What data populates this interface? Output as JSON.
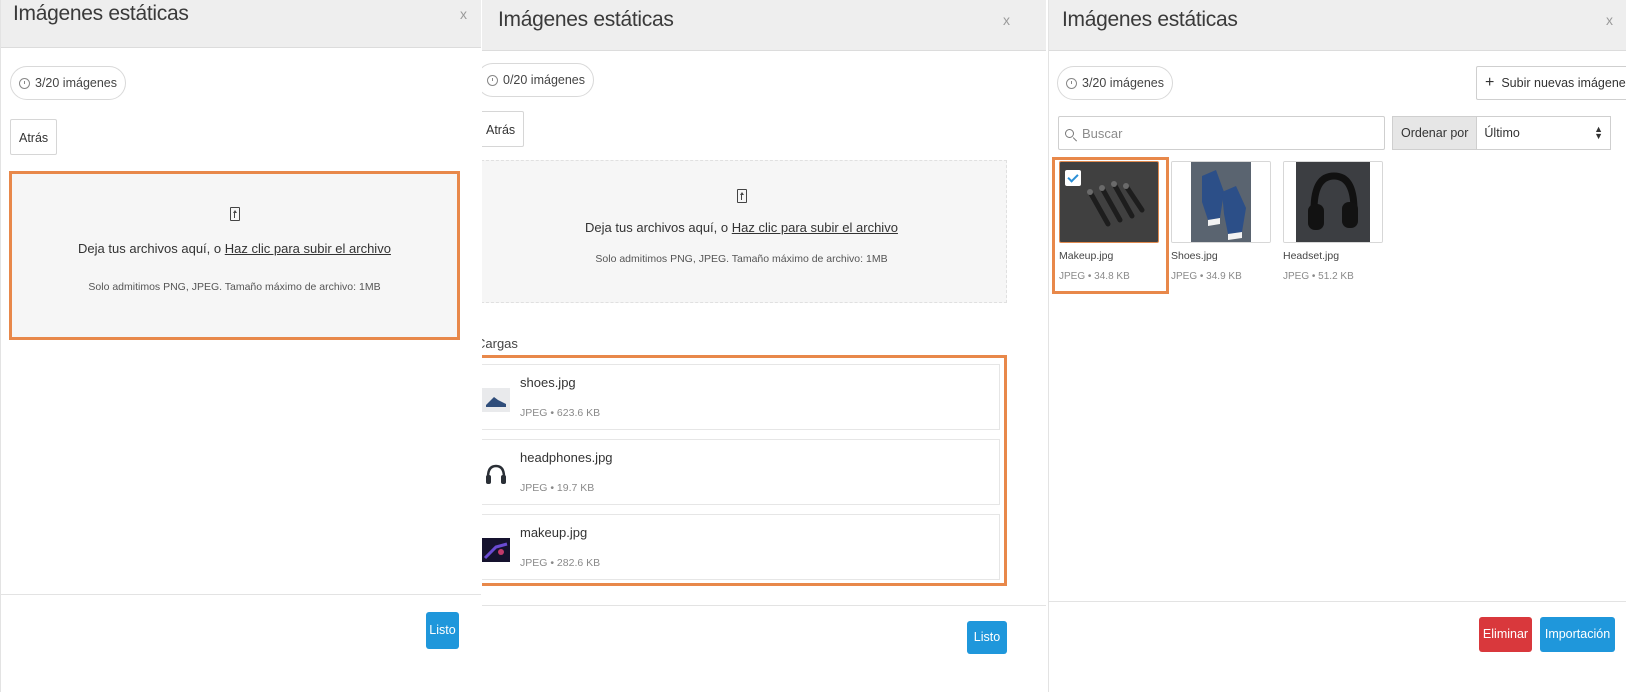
{
  "panel1": {
    "title": "Imágenes estáticas",
    "close": "x",
    "counter": "3/20 imágenes",
    "back_label": "Atrás",
    "dropzone": {
      "prefix": "Deja tus archivos aquí, o ",
      "link": "Haz clic para subir el archivo",
      "note": "Solo admitimos PNG, JPEG. Tamaño máximo de archivo: 1MB"
    },
    "done_label": "Listo"
  },
  "panel2": {
    "title": "Imágenes estáticas",
    "close": "x",
    "counter": "0/20 imágenes",
    "back_label": "Atrás",
    "dropzone": {
      "prefix": "Deja tus archivos aquí, o ",
      "link": "Haz clic para subir el archivo",
      "note": "Solo admitimos PNG, JPEG. Tamaño máximo de archivo: 1MB"
    },
    "uploads_label": "Cargas",
    "uploads": [
      {
        "name": "shoes.jpg",
        "meta": "JPEG • 623.6 KB"
      },
      {
        "name": "headphones.jpg",
        "meta": "JPEG • 19.7 KB"
      },
      {
        "name": "makeup.jpg",
        "meta": "JPEG • 282.6 KB"
      }
    ],
    "done_label": "Listo"
  },
  "panel3": {
    "title": "Imágenes estáticas",
    "close": "x",
    "counter": "3/20 imágenes",
    "upload_new_label": "Subir nuevas imágenes",
    "search_placeholder": "Buscar",
    "sort_label": "Ordenar por",
    "sort_value": "Último",
    "images": [
      {
        "name": "Makeup.jpg",
        "meta": "JPEG • 34.8 KB",
        "selected": true
      },
      {
        "name": "Shoes.jpg",
        "meta": "JPEG • 34.9 KB",
        "selected": false
      },
      {
        "name": "Headset.jpg",
        "meta": "JPEG • 51.2 KB",
        "selected": false
      }
    ],
    "delete_label": "Eliminar",
    "import_label": "Importación"
  },
  "colors": {
    "accent": "#1f97db",
    "danger": "#d9383c",
    "highlight": "#e8884a",
    "header_bg": "#eeeeee"
  }
}
